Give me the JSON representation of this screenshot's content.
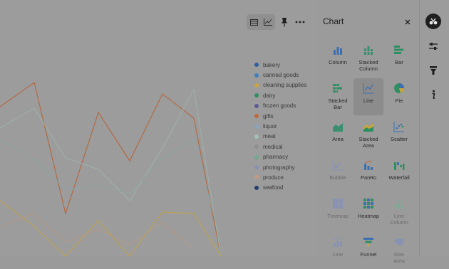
{
  "panel": {
    "title": "Chart"
  },
  "icons": {
    "table": "table-icon",
    "line_chart": "line-chart-icon",
    "pin": "pin-icon",
    "more": "ellipsis-icon",
    "close": "close-icon",
    "rail": [
      "chart-settings-icon",
      "sliders-icon",
      "funnel-filter-icon",
      "info-icon"
    ]
  },
  "legend": [
    {
      "label": "bakery",
      "color": "#2f5f9e"
    },
    {
      "label": "canned goods",
      "color": "#3d7fbf"
    },
    {
      "label": "cleaning supplies",
      "color": "#c9a63a"
    },
    {
      "label": "dairy",
      "color": "#2f8e62"
    },
    {
      "label": "frozen goods",
      "color": "#5c5a96"
    },
    {
      "label": "gifts",
      "color": "#c06a3a"
    },
    {
      "label": "liquor",
      "color": "#8aa4c4"
    },
    {
      "label": "meat",
      "color": "#a6c0ba"
    },
    {
      "label": "medical",
      "color": "#8e8e8e"
    },
    {
      "label": "pharmacy",
      "color": "#6fa98e"
    },
    {
      "label": "photography",
      "color": "#8a92b4"
    },
    {
      "label": "produce",
      "color": "#c49a82"
    },
    {
      "label": "seafood",
      "color": "#263f6e"
    }
  ],
  "chart_types": [
    {
      "label": "Column",
      "icon": "column-chart-icon",
      "selected": false,
      "disabled": false,
      "color": "#3d6fb0"
    },
    {
      "label": "Stacked Column",
      "icon": "stacked-column-icon",
      "selected": false,
      "disabled": false,
      "color": "#3a8f70"
    },
    {
      "label": "Bar",
      "icon": "bar-chart-icon",
      "selected": false,
      "disabled": false,
      "color": "#2f8e62"
    },
    {
      "label": "Stacked Bar",
      "icon": "stacked-bar-icon",
      "selected": false,
      "disabled": false,
      "color": "#2f8e62"
    },
    {
      "label": "Line",
      "icon": "line-chart-icon",
      "selected": true,
      "disabled": false,
      "color": "#3d6fb0"
    },
    {
      "label": "Pie",
      "icon": "pie-chart-icon",
      "selected": false,
      "disabled": false,
      "color": "#2f8e62"
    },
    {
      "label": "Area",
      "icon": "area-chart-icon",
      "selected": false,
      "disabled": false,
      "color": "#3a8f70"
    },
    {
      "label": "Stacked Area",
      "icon": "stacked-area-icon",
      "selected": false,
      "disabled": false,
      "color": "#c9a63a"
    },
    {
      "label": "Scatter",
      "icon": "scatter-chart-icon",
      "selected": false,
      "disabled": false,
      "color": "#3d6fb0"
    },
    {
      "label": "Bubble",
      "icon": "bubble-chart-icon",
      "selected": false,
      "disabled": true,
      "color": "#8a92b4"
    },
    {
      "label": "Pareto",
      "icon": "pareto-chart-icon",
      "selected": false,
      "disabled": false,
      "color": "#3d6fb0"
    },
    {
      "label": "Waterfall",
      "icon": "waterfall-chart-icon",
      "selected": false,
      "disabled": false,
      "color": "#2f8e62"
    },
    {
      "label": "Treemap",
      "icon": "treemap-icon",
      "selected": false,
      "disabled": true,
      "color": "#8a92b4"
    },
    {
      "label": "Heatmap",
      "icon": "heatmap-icon",
      "selected": false,
      "disabled": false,
      "color": "#2f8e62"
    },
    {
      "label": "Line Column",
      "icon": "line-column-icon",
      "selected": false,
      "disabled": true,
      "color": "#7fa895"
    },
    {
      "label": "Line",
      "icon": "line-stacked-icon",
      "selected": false,
      "disabled": true,
      "color": "#8a92b4"
    },
    {
      "label": "Funnel",
      "icon": "funnel-chart-icon",
      "selected": false,
      "disabled": false,
      "color": "#3d6fb0"
    },
    {
      "label": "Geo Area",
      "icon": "geo-area-icon",
      "selected": false,
      "disabled": true,
      "color": "#8a92b4"
    }
  ]
}
